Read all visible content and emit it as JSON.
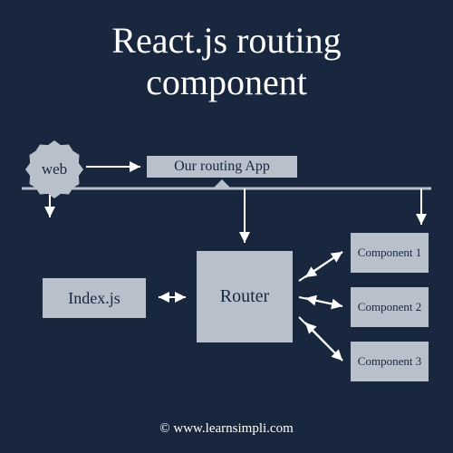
{
  "title_line1": "React.js  routing",
  "title_line2": "component",
  "nodes": {
    "web": "web",
    "routing_app": "Our routing App",
    "index_js": "Index.js",
    "router": "Router",
    "component1": "Component 1",
    "component2": "Component 2",
    "component3": "Component 3"
  },
  "footer": "© www.learnsimpli.com",
  "colors": {
    "background": "#18273e",
    "box_fill": "#b8c1cb",
    "text_light": "#ffffff",
    "text_dark": "#18273e"
  }
}
